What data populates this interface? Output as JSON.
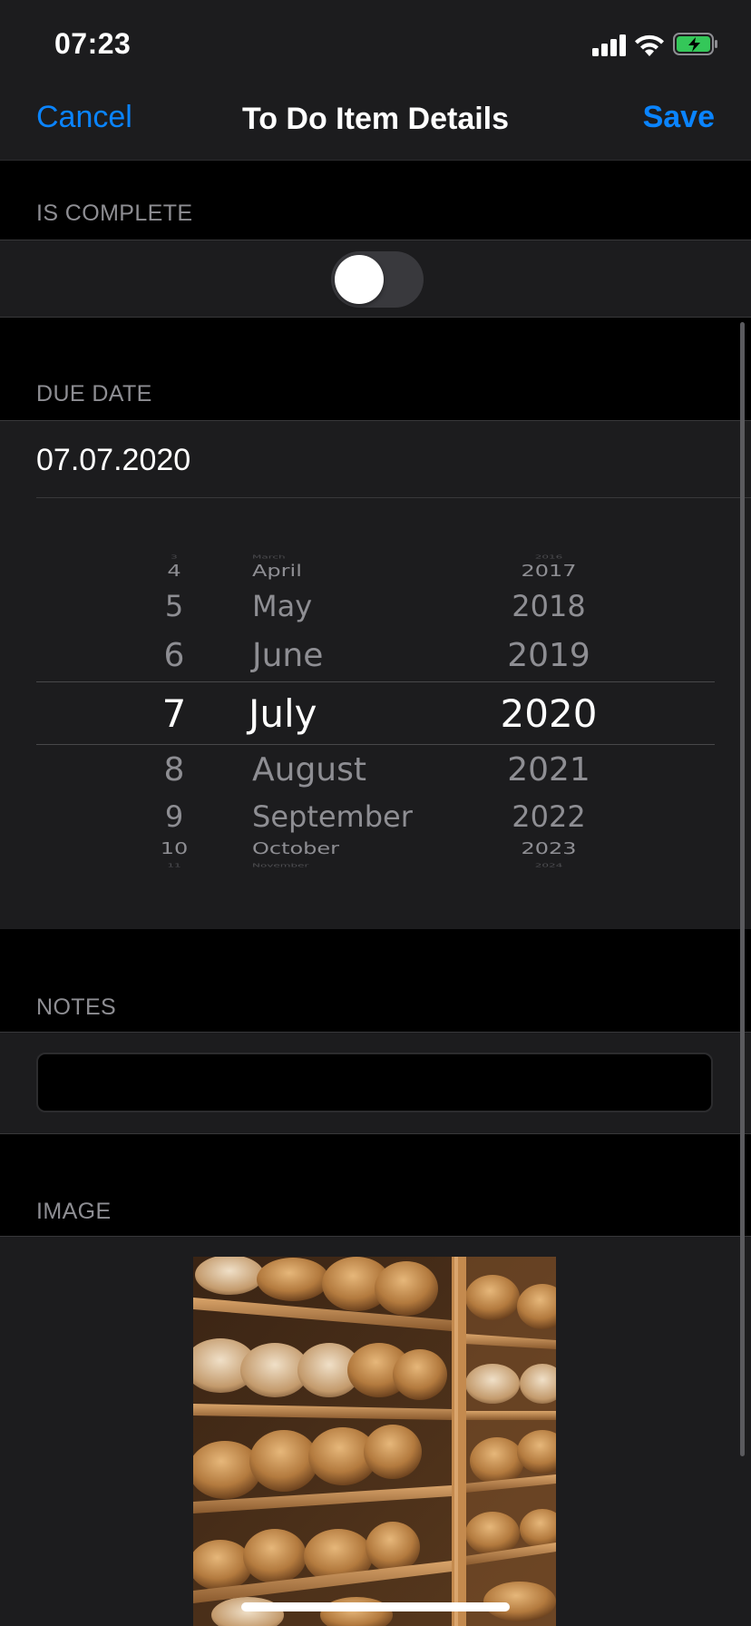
{
  "status_bar": {
    "time": "07:23"
  },
  "nav": {
    "cancel": "Cancel",
    "title": "To Do Item Details",
    "save": "Save"
  },
  "sections": {
    "is_complete": "IS COMPLETE",
    "due_date": "DUE DATE",
    "notes": "NOTES",
    "image": "IMAGE"
  },
  "is_complete": {
    "on": false
  },
  "due_date": {
    "value": "07.07.2020"
  },
  "picker": {
    "days": [
      "3",
      "4",
      "5",
      "6",
      "7",
      "8",
      "9",
      "10",
      "11"
    ],
    "months": [
      "March",
      "April",
      "May",
      "June",
      "July",
      "August",
      "September",
      "October",
      "November"
    ],
    "years": [
      "2016",
      "2017",
      "2018",
      "2019",
      "2020",
      "2021",
      "2022",
      "2023",
      "2024"
    ],
    "selected": {
      "day": "7",
      "month": "July",
      "year": "2020"
    }
  },
  "notes": {
    "value": ""
  },
  "image": {
    "subject": "bakery-shelves-with-bread"
  },
  "colors": {
    "accent": "#0a84ff",
    "cell_background": "#1c1c1e",
    "page_background": "#000000"
  }
}
